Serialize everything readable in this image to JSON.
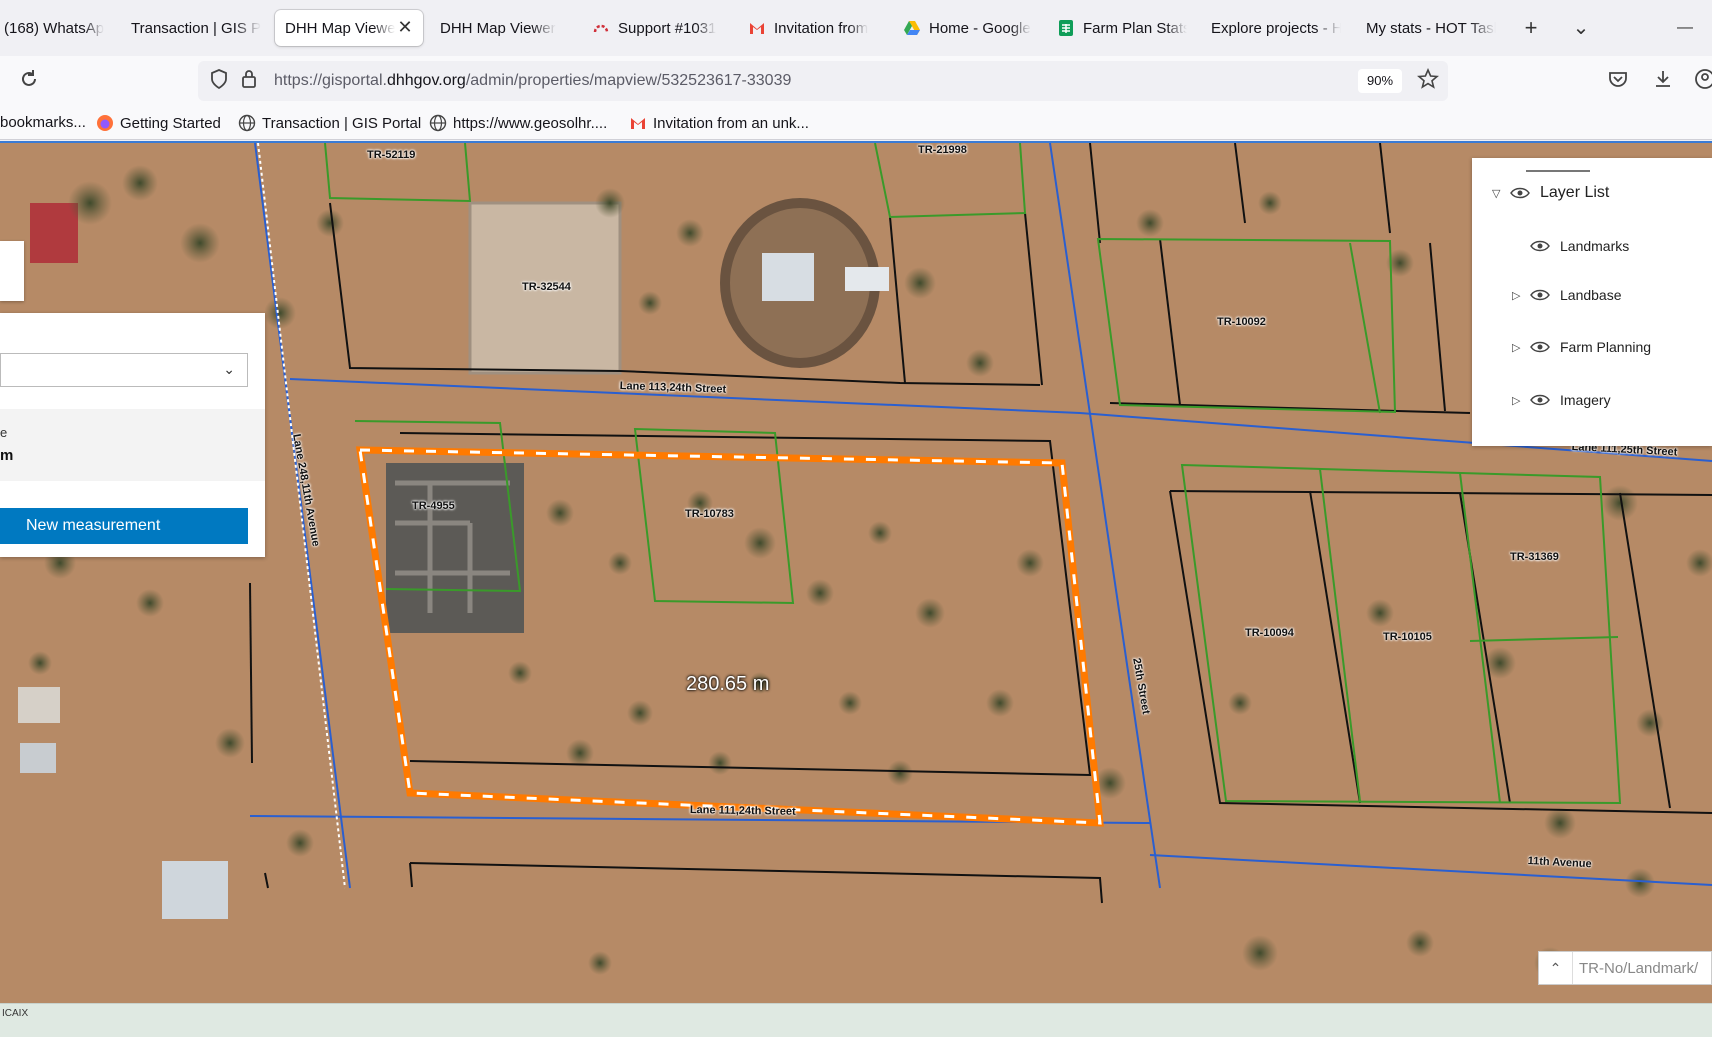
{
  "browser": {
    "tabs": [
      {
        "label": "(168) WhatsApp",
        "icon": "whatsapp-icon"
      },
      {
        "label": "Transaction | GIS Po",
        "icon": "none"
      },
      {
        "label": "DHH Map Viewer",
        "icon": "none",
        "active": true
      },
      {
        "label": "DHH Map Viewer",
        "icon": "none"
      },
      {
        "label": "Support #1031",
        "icon": "support-icon"
      },
      {
        "label": "Invitation from",
        "icon": "gmail-icon"
      },
      {
        "label": "Home - Google",
        "icon": "google-drive-icon"
      },
      {
        "label": "Farm Plan Stats",
        "icon": "sheets-icon"
      },
      {
        "label": "Explore projects - H",
        "icon": "none"
      },
      {
        "label": "My stats - HOT Task",
        "icon": "none"
      }
    ],
    "new_tab": "+",
    "tab_list": "⌄",
    "minimize": "—",
    "url_prefix": "https://gisportal.",
    "url_domain": "dhhgov.org",
    "url_path": "/admin/properties/mapview/532523617-33039",
    "zoom": "90%",
    "bookmarks": [
      {
        "label": "bookmarks...",
        "icon": "none"
      },
      {
        "label": "Getting Started",
        "icon": "firefox-icon"
      },
      {
        "label": "Transaction | GIS Portal",
        "icon": "globe-icon"
      },
      {
        "label": "https://www.geosolhr....",
        "icon": "globe-icon"
      },
      {
        "label": "Invitation from an unk...",
        "icon": "gmail-icon"
      }
    ]
  },
  "map": {
    "parcels": [
      "TR-52119",
      "TR-21998",
      "TR-32544",
      "TR-10092",
      "TR-4955",
      "TR-10783",
      "TR-10094",
      "TR-10105",
      "TR-31369"
    ],
    "streets": [
      "Lane 113,24th Street",
      "Lane 111,25th Street",
      "Lane 248,11th Avenue",
      "25th Street",
      "Lane 111,24th Street",
      "11th Avenue"
    ],
    "measurement": "280.65 m"
  },
  "measure_widget": {
    "result_key": "e",
    "result_value": "m",
    "new_measurement": "New measurement"
  },
  "layer_list": {
    "title": "Layer List",
    "layers": [
      "Landmarks",
      "Landbase",
      "Farm Planning",
      "Imagery"
    ]
  },
  "search": {
    "placeholder": "TR-No/Landmark/"
  },
  "taskbar": {
    "text": "ICAIX"
  }
}
